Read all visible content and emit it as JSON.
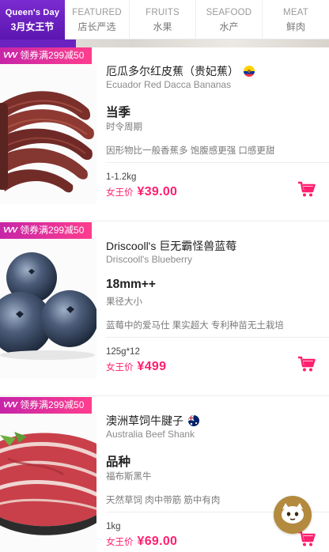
{
  "tabs": [
    {
      "en": "Queen's Day",
      "cn": "3月女王节",
      "active": true
    },
    {
      "en": "FEATURED",
      "cn": "店长严选"
    },
    {
      "en": "FRUITS",
      "cn": "水果"
    },
    {
      "en": "SEAFOOD",
      "cn": "水产"
    },
    {
      "en": "MEAT",
      "cn": "鲜肉"
    }
  ],
  "colors": {
    "brand_purple": "#6a22c0",
    "price_pink": "#ff1f6f",
    "promo_gradient_start": "#c625a8",
    "promo_gradient_end": "#ff3d8d",
    "fab_gold": "#b38a3e"
  },
  "products": [
    {
      "promo": "领券满299减50",
      "promo_mark": "VVV",
      "name_cn": "厄瓜多尔红皮蕉（贵妃蕉）",
      "name_en": "Ecuador Red Dacca Bananas",
      "flag_icon": "ecuador-flag-icon",
      "headline": "当季",
      "sub": "时令周期",
      "desc": "因形物比一般香蕉多 饱腹感更强 口感更甜",
      "weight": "1-1.2kg",
      "price_label": "女王价",
      "price": "¥39.00",
      "image_icon": "red-bananas-photo"
    },
    {
      "promo": "领券满299减50",
      "promo_mark": "VVV",
      "name_cn": "Driscooll's 巨无霸怪兽蓝莓",
      "name_en": "Driscooll's Blueberry",
      "headline": "18mm++",
      "sub": "果径大小",
      "desc": "蓝莓中的爱马仕 果实超大 专利种苗无土栽培",
      "weight": "125g*12",
      "price_label": "女王价",
      "price": "¥499",
      "image_icon": "blueberries-photo"
    },
    {
      "promo": "领券满299减50",
      "promo_mark": "VVV",
      "name_cn": "澳洲草饲牛腱子",
      "name_en": "Australia Beef Shank",
      "flag_icon": "australia-flag-icon",
      "headline": "品种",
      "sub": "福布斯黑牛",
      "desc": "天然草饲 肉中带筋 筋中有肉",
      "weight": "1kg",
      "price_label": "女王价",
      "price": "¥69.00",
      "image_icon": "beef-shank-photo"
    }
  ],
  "fab": {
    "icon": "chat-mascot-icon"
  }
}
